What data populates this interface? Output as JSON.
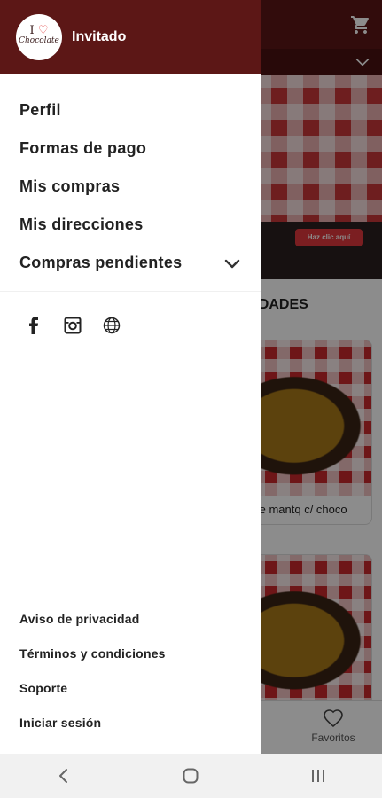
{
  "background": {
    "banner_button": "Haz clic aquí",
    "section_title": "CIALIDADES",
    "cards": [
      {
        "title": "te mantq c/ choco"
      },
      {
        "title": ""
      }
    ],
    "bottom_nav": {
      "favorites_label": "Favoritos"
    }
  },
  "drawer": {
    "user_name": "Invitado",
    "logo_text": "Chocolate",
    "menu_items": [
      {
        "label": "Perfil"
      },
      {
        "label": "Formas de pago"
      },
      {
        "label": "Mis compras"
      },
      {
        "label": "Mis direcciones"
      },
      {
        "label": "Compras pendientes",
        "expandable": true
      }
    ],
    "social_icons": [
      "facebook-icon",
      "instagram-icon",
      "globe-icon"
    ],
    "footer_links": [
      {
        "label": "Aviso de privacidad"
      },
      {
        "label": "Términos y condiciones"
      },
      {
        "label": "Soporte"
      },
      {
        "label": "Iniciar sesión"
      }
    ]
  },
  "colors": {
    "brand": "#5c1716",
    "text": "#222222"
  }
}
